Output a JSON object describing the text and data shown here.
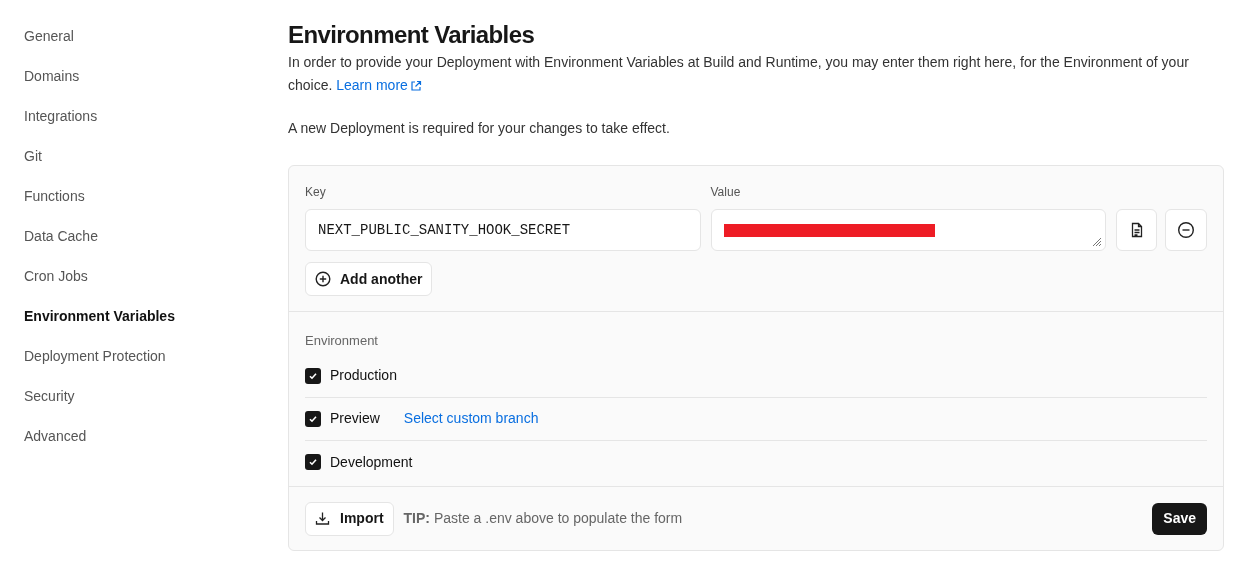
{
  "sidebar": {
    "items": [
      {
        "label": "General",
        "selected": false
      },
      {
        "label": "Domains",
        "selected": false
      },
      {
        "label": "Integrations",
        "selected": false
      },
      {
        "label": "Git",
        "selected": false
      },
      {
        "label": "Functions",
        "selected": false
      },
      {
        "label": "Data Cache",
        "selected": false
      },
      {
        "label": "Cron Jobs",
        "selected": false
      },
      {
        "label": "Environment Variables",
        "selected": true
      },
      {
        "label": "Deployment Protection",
        "selected": false
      },
      {
        "label": "Security",
        "selected": false
      },
      {
        "label": "Advanced",
        "selected": false
      }
    ]
  },
  "page": {
    "title": "Environment Variables",
    "intro": "In order to provide your Deployment with Environment Variables at Build and Runtime, you may enter them right here, for the Environment of your choice.",
    "learn_more": "Learn more",
    "notice": "A new Deployment is required for your changes to take effect."
  },
  "form": {
    "key_label": "Key",
    "value_label": "Value",
    "key_value": "NEXT_PUBLIC_SANITY_HOOK_SECRET",
    "value_redacted": true,
    "add_another": "Add another",
    "environment_label": "Environment",
    "environments": [
      {
        "label": "Production",
        "checked": true
      },
      {
        "label": "Preview",
        "checked": true,
        "link": "Select custom branch"
      },
      {
        "label": "Development",
        "checked": true
      }
    ],
    "import": "Import",
    "tip": "**TIP:** Paste a .env above to populate the form",
    "save": "Save"
  }
}
